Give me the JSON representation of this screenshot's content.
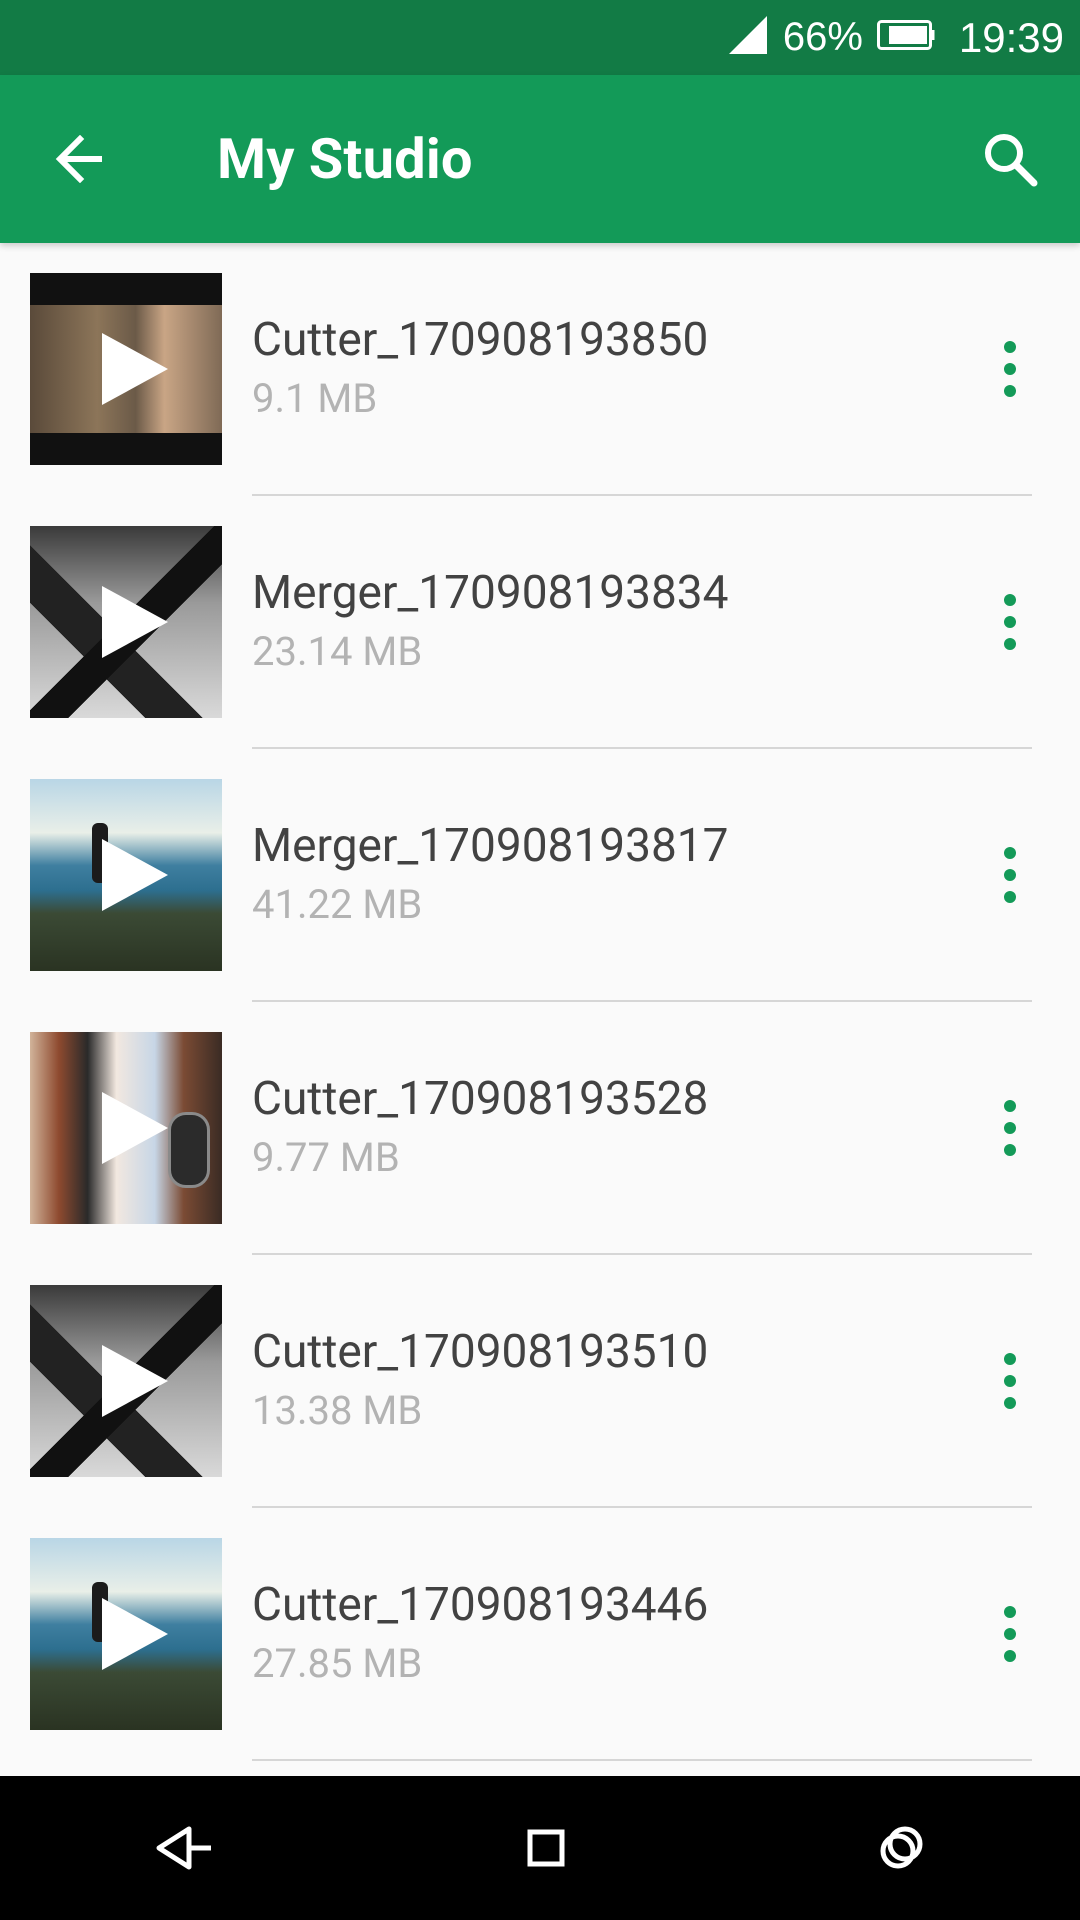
{
  "status_bar": {
    "battery_percent": "66%",
    "time": "19:39",
    "icons": [
      "signal-icon",
      "battery-icon"
    ]
  },
  "app_bar": {
    "title": "My Studio",
    "back_icon": "back-arrow-icon",
    "search_icon": "search-icon"
  },
  "colors": {
    "status_bar": "#127b45",
    "app_bar": "#139a58",
    "accent": "#139a58",
    "background": "#fafafa",
    "name_text": "#424242",
    "size_text": "#b3b3b3",
    "nav_bar": "#000000"
  },
  "items": [
    {
      "name": "Cutter_170908193850",
      "size": "9.1 MB"
    },
    {
      "name": "Merger_170908193834",
      "size": "23.14 MB"
    },
    {
      "name": "Merger_170908193817",
      "size": "41.22 MB"
    },
    {
      "name": "Cutter_170908193528",
      "size": "9.77 MB"
    },
    {
      "name": "Cutter_170908193510",
      "size": "13.38 MB"
    },
    {
      "name": "Cutter_170908193446",
      "size": "27.85 MB"
    }
  ],
  "nav_bar": {
    "icons": [
      "nav-back-icon",
      "nav-home-icon",
      "nav-recents-icon"
    ]
  }
}
